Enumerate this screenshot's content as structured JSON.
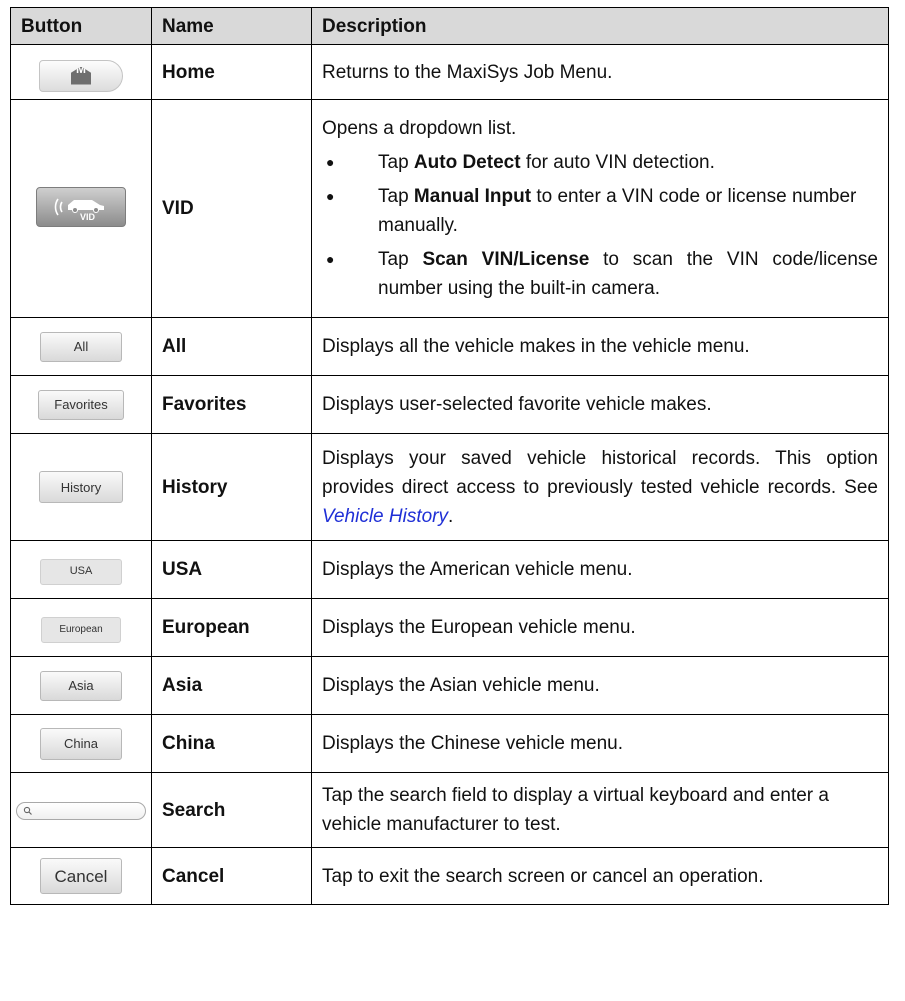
{
  "table": {
    "headers": [
      "Button",
      "Name",
      "Description"
    ],
    "rows": [
      {
        "icon": "home-button-icon",
        "button_text": "M",
        "name": "Home",
        "description": "Returns to the MaxiSys Job Menu."
      },
      {
        "icon": "vid-button-icon",
        "button_text": "VID",
        "name": "VID",
        "description": "Opens a dropdown list.",
        "bullets": [
          {
            "pre": "Tap ",
            "bold": "Auto Detect",
            "post": " for auto VIN detection."
          },
          {
            "pre": "Tap ",
            "bold": "Manual Input",
            "post": " to enter a VIN code or license number manually."
          },
          {
            "pre": "Tap ",
            "bold": "Scan VIN/License",
            "post": " to scan the VIN code/license number using the built-in camera."
          }
        ]
      },
      {
        "button_text": "All",
        "name": "All",
        "description": "Displays all the vehicle makes in the vehicle menu."
      },
      {
        "button_text": "Favorites",
        "name": "Favorites",
        "description": "Displays user-selected favorite vehicle makes."
      },
      {
        "button_text": "History",
        "name": "History",
        "description_pre": "Displays your saved vehicle historical records. This option provides direct access to previously tested vehicle records. See ",
        "description_link": "Vehicle History",
        "description_post": "."
      },
      {
        "button_text": "USA",
        "name": "USA",
        "description": "Displays the American vehicle menu."
      },
      {
        "button_text": "European",
        "name": "European",
        "description": "Displays the European vehicle menu."
      },
      {
        "button_text": "Asia",
        "name": "Asia",
        "description": "Displays the Asian vehicle menu."
      },
      {
        "button_text": "China",
        "name": "China",
        "description": "Displays the Chinese vehicle menu."
      },
      {
        "icon": "search-field-icon",
        "name": "Search",
        "description": "Tap the search field to display a virtual keyboard and enter a vehicle manufacturer to test."
      },
      {
        "button_text": "Cancel",
        "name": "Cancel",
        "description": "Tap to exit the search screen or cancel an operation."
      }
    ]
  },
  "colors": {
    "header_bg": "#d9d9d9",
    "link": "#1f2fd6",
    "border": "#000000"
  }
}
